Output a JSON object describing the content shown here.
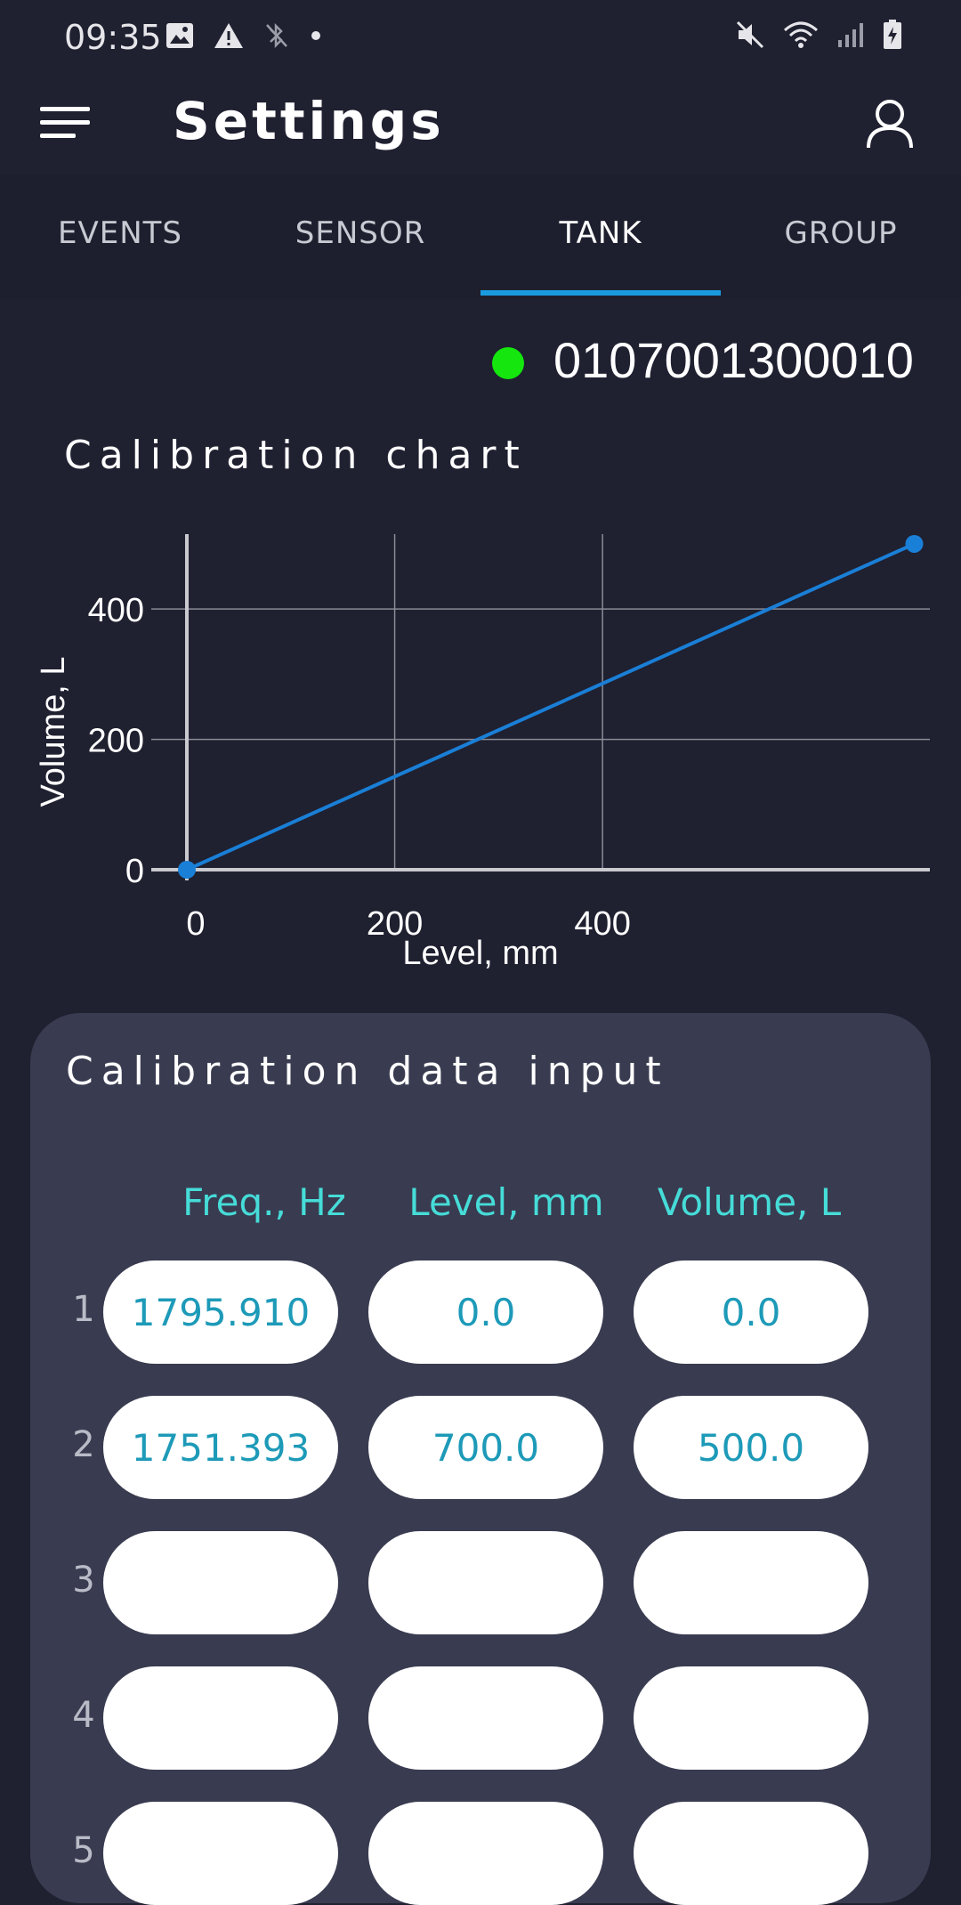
{
  "status_bar": {
    "time": "09:35",
    "left_icons": [
      "image-icon",
      "warning-icon",
      "bluetooth-off-icon",
      "dot-icon"
    ],
    "right_icons": [
      "mute-icon",
      "wifi-icon",
      "signal-icon",
      "battery-charging-icon"
    ]
  },
  "appbar": {
    "title": "Settings"
  },
  "tabs": [
    {
      "label": "EVENTS",
      "active": false
    },
    {
      "label": "SENSOR",
      "active": false
    },
    {
      "label": "TANK",
      "active": true
    },
    {
      "label": "GROUP",
      "active": false
    }
  ],
  "device": {
    "id": "0107001300010",
    "status_color": "#14e60e"
  },
  "chart_section": {
    "title": "Calibration chart"
  },
  "chart_data": {
    "type": "line",
    "xlabel": "Level, mm",
    "ylabel": "Volume, L",
    "x_ticks": [
      0,
      200,
      400
    ],
    "y_ticks": [
      0,
      200,
      400
    ],
    "xlim": [
      0,
      715
    ],
    "ylim": [
      0,
      515
    ],
    "grid": true,
    "series": [
      {
        "color": "#1a7fd6",
        "points": [
          [
            0,
            0
          ],
          [
            700,
            500
          ]
        ]
      }
    ]
  },
  "calibration": {
    "title": "Calibration data input",
    "columns": [
      "Freq., Hz",
      "Level, mm",
      "Volume, L"
    ],
    "rows": [
      {
        "num": "1",
        "freq": "1795.910",
        "level": "0.0",
        "volume": "0.0"
      },
      {
        "num": "2",
        "freq": "1751.393",
        "level": "700.0",
        "volume": "500.0"
      },
      {
        "num": "3",
        "freq": "",
        "level": "",
        "volume": ""
      },
      {
        "num": "4",
        "freq": "",
        "level": "",
        "volume": ""
      },
      {
        "num": "5",
        "freq": "",
        "level": "",
        "volume": ""
      }
    ]
  },
  "colors": {
    "background": "#1f2030",
    "card": "#393b50",
    "accent": "#1a9be0",
    "header_text": "#46dcd8",
    "value_text": "#1d9ab8"
  }
}
